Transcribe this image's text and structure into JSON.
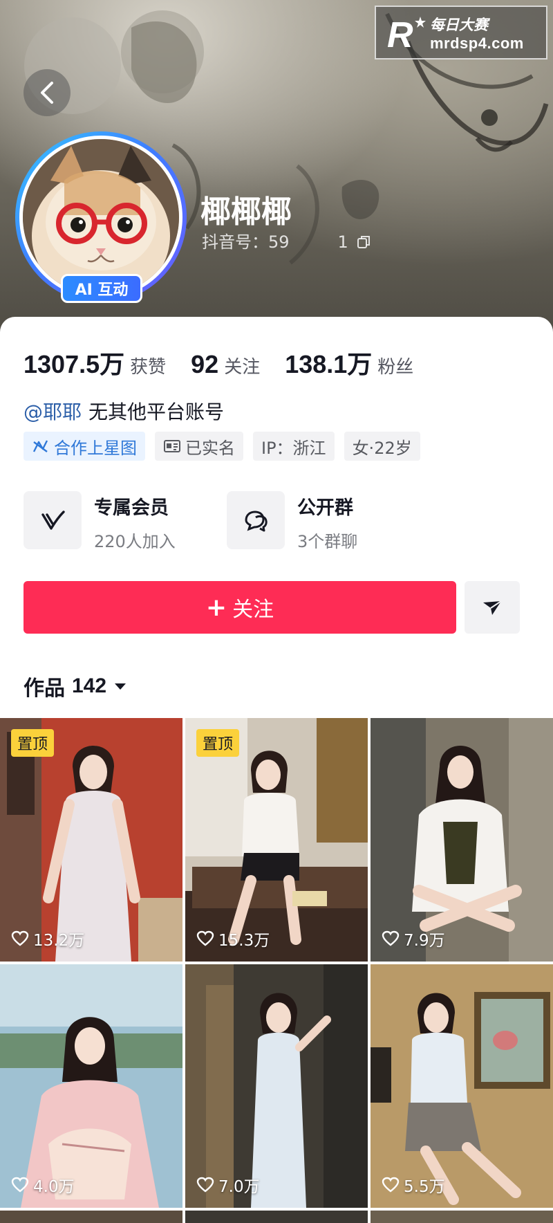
{
  "watermark": {
    "title": "每日大赛",
    "url": "mrdsp4.com",
    "logo_letter": "R"
  },
  "profile": {
    "nickname": "椰椰椰",
    "douyin_id_label": "抖音号：",
    "douyin_id_left": "59",
    "douyin_id_right": "1",
    "ai_badge": "AI 互动",
    "avatar_icon": "cat-with-red-glasses-avatar"
  },
  "stats": [
    {
      "value": "1307.5万",
      "label": "获赞"
    },
    {
      "value": "92",
      "label": "关注"
    },
    {
      "value": "138.1万",
      "label": "粉丝"
    }
  ],
  "bio": {
    "mention": "@耶耶",
    "text": "无其他平台账号"
  },
  "tags": [
    {
      "label": "合作上星图",
      "icon": "star-map-icon"
    },
    {
      "label": "已实名",
      "icon": "id-card-icon"
    },
    {
      "label": "IP：浙江"
    },
    {
      "label": "女·22岁"
    }
  ],
  "features": [
    {
      "title": "专属会员",
      "sub": "220人加入",
      "icon": "v-member-icon"
    },
    {
      "title": "公开群",
      "sub": "3个群聊",
      "icon": "chat-bubbles-icon"
    }
  ],
  "actions": {
    "follow_label": "关注",
    "follow_plus": "+"
  },
  "works": {
    "label": "作品",
    "count": "142"
  },
  "videos": [
    {
      "pinned_label": "置顶",
      "likes": "13.2万"
    },
    {
      "pinned_label": "置顶",
      "likes": "15.3万"
    },
    {
      "pinned_label": "",
      "likes": "7.9万"
    },
    {
      "pinned_label": "",
      "likes": "4.0万"
    },
    {
      "pinned_label": "",
      "likes": "7.0万"
    },
    {
      "pinned_label": "",
      "likes": "5.5万"
    }
  ],
  "colors": {
    "follow_button": "#fe2c55",
    "mention": "#2b5ea8",
    "tag_blue": "#2f78d8",
    "pin_badge": "#fbd13b",
    "avatar_ring": "#3f7dff"
  }
}
